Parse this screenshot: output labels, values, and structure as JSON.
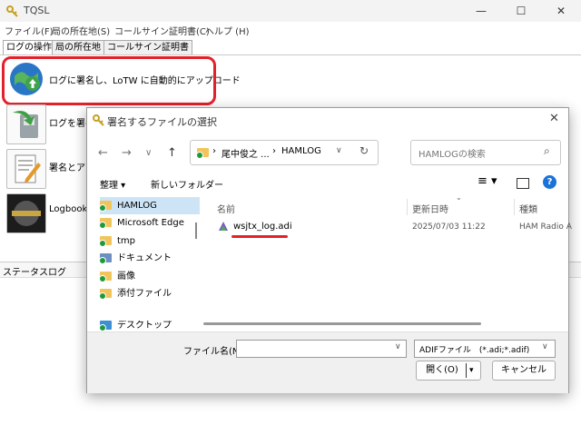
{
  "app": {
    "title": "TQSL",
    "window_buttons": [
      "—",
      "☐",
      "✕"
    ]
  },
  "menu": [
    "ファイル(F)",
    "局の所在地(S)",
    "コールサイン証明書(C)",
    "ヘルプ (H)"
  ],
  "tabs": [
    "ログの操作",
    "局の所在地",
    "コールサイン証明書"
  ],
  "actions": [
    {
      "label": "ログに署名し、LoTW に自動的にアップロード",
      "icon": "globe-upload-icon"
    },
    {
      "label": "ログを署名",
      "icon": "save-log-icon"
    },
    {
      "label": "署名とアッ",
      "icon": "sign-edit-icon"
    },
    {
      "label": "Logbook",
      "icon": "logbook-icon"
    }
  ],
  "status_log_label": "ステータスログ",
  "dialog": {
    "title": "署名するファイルの選択",
    "path": [
      "尾中俊之 ...",
      "HAMLOG"
    ],
    "search_placeholder": "HAMLOGの検索",
    "organize_label": "整理 ▾",
    "new_folder_label": "新しいフォルダー",
    "nav_items": [
      {
        "label": "HAMLOG",
        "selected": true
      },
      {
        "label": "Microsoft Edge",
        "selected": false
      },
      {
        "label": "tmp",
        "selected": false
      },
      {
        "label": "ドキュメント",
        "selected": false
      },
      {
        "label": "画像",
        "selected": false
      },
      {
        "label": "添付ファイル",
        "selected": false
      },
      {
        "label": "デスクトップ",
        "selected": false
      }
    ],
    "columns": [
      "名前",
      "更新日時",
      "種類"
    ],
    "files": [
      {
        "name": "wsjtx_log.adi",
        "modified": "2025/07/03 11:22",
        "type": "HAM Radio A"
      }
    ],
    "filename_label": "ファイル名(N):",
    "filename_value": "",
    "filetype_value": "ADIFファイル　(*.adi;*.adif)",
    "open_label": "開く(O)",
    "cancel_label": "キャンセル"
  },
  "colors": {
    "highlight": "#e4212b",
    "selection": "#cde4f7",
    "folder": "#f2c55c",
    "help": "#1a73d9"
  }
}
